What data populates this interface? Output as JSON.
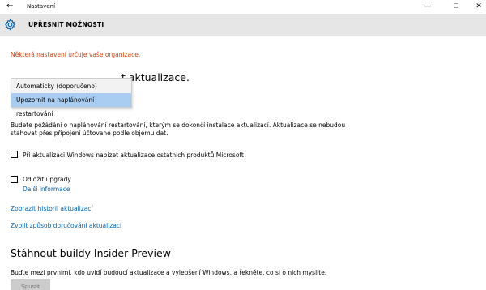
{
  "window": {
    "title": "Nastavení",
    "back_glyph": "←",
    "minimize_glyph": "—",
    "maximize_glyph": "☐",
    "close_glyph": "✕"
  },
  "header": {
    "title": "UPŘESNIT MOŽNOSTI",
    "icon": "gear-icon",
    "background": "#e6e6e6",
    "icon_color": "#0063b1"
  },
  "notice": {
    "text": "Některá nastavení určuje vaše organizace.",
    "color": "#d4420c"
  },
  "install_section": {
    "heading_visible": "t aktualizace.",
    "dropdown": {
      "options": [
        "Automaticky (doporučeno)",
        "Upozornit na naplánování restartování"
      ],
      "selected_index": 1,
      "highlight_color": "#a9cdf0"
    },
    "description": "Budete požádáni o naplánování restartování, kterým se dokončí instalace aktualizací. Aktualizace se nebudou stahovat přes připojení účtované podle objemu dat."
  },
  "options": [
    {
      "label": "Při aktualizaci Windows nabízet aktualizace ostatních produktů Microsoft",
      "checked": false
    },
    {
      "label": "Odložit upgrady",
      "checked": false,
      "link": "Další informace"
    }
  ],
  "links": {
    "history": "Zobrazit historii aktualizací",
    "delivery": "Zvolit způsob doručování aktualizací",
    "color": "#0063b1"
  },
  "insider": {
    "title": "Stáhnout buildy Insider Preview",
    "description": "Buďte mezi prvními, kdo uvidí budoucí aktualizace a vylepšení Windows, a řekněte, co si o nich myslíte.",
    "button_label": "Spustit",
    "button_disabled": true
  }
}
